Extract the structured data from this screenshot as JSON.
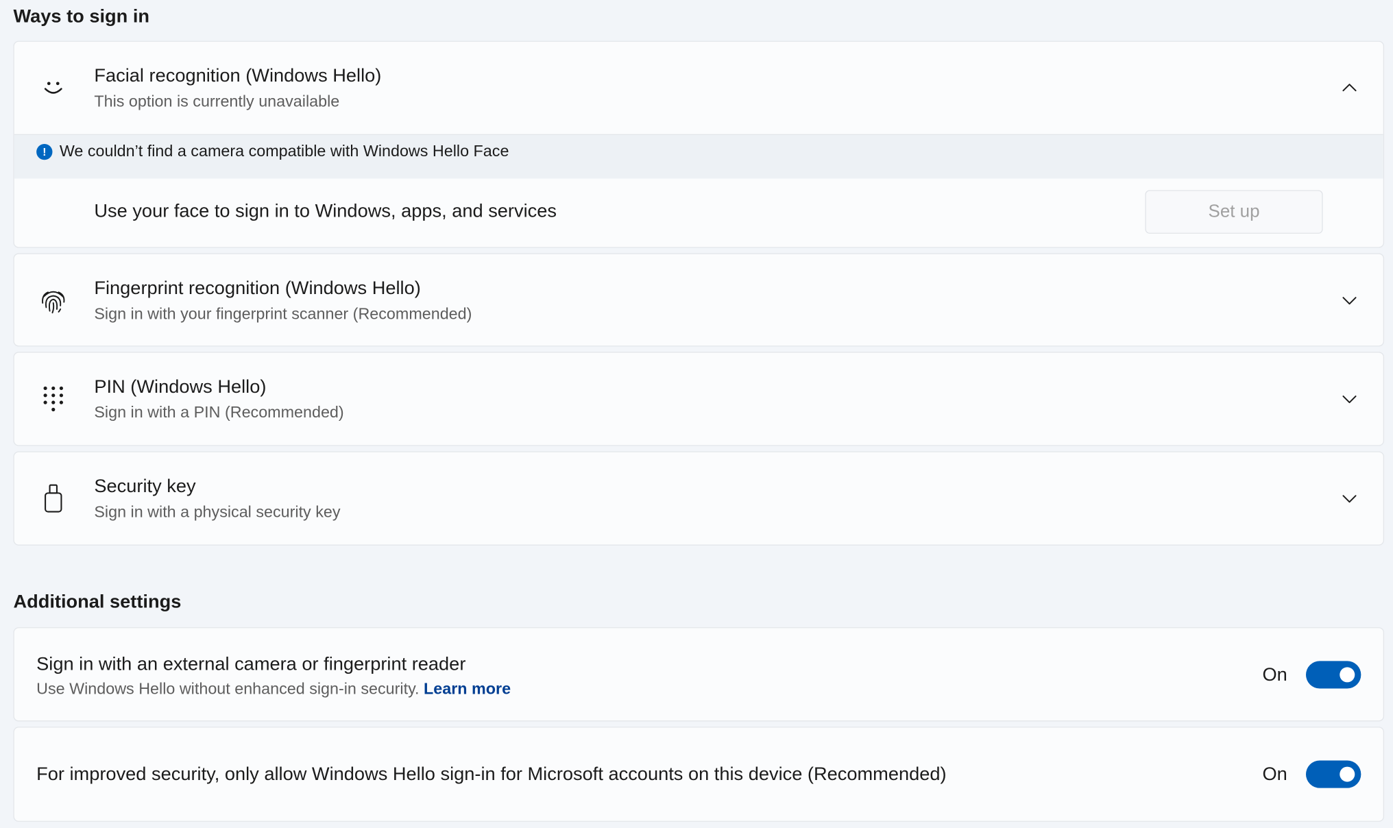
{
  "sections": {
    "ways_title": "Ways to sign in",
    "additional_title": "Additional settings"
  },
  "sign_in_options": [
    {
      "title": "Facial recognition (Windows Hello)",
      "subtitle": "This option is currently unavailable",
      "icon": "smile-face-icon",
      "expanded": true
    },
    {
      "title": "Fingerprint recognition (Windows Hello)",
      "subtitle": "Sign in with your fingerprint scanner (Recommended)",
      "icon": "fingerprint-icon",
      "expanded": false
    },
    {
      "title": "PIN (Windows Hello)",
      "subtitle": "Sign in with a PIN (Recommended)",
      "icon": "keypad-icon",
      "expanded": false
    },
    {
      "title": "Security key",
      "subtitle": "Sign in with a physical security key",
      "icon": "usb-key-icon",
      "expanded": false
    }
  ],
  "face": {
    "info_message": "We couldn’t find a camera compatible with Windows Hello Face",
    "description": "Use your face to sign in to Windows, apps, and services",
    "setup_label": "Set up"
  },
  "additional": {
    "external_camera": {
      "title": "Sign in with an external camera or fingerprint reader",
      "subtitle": "Use Windows Hello without enhanced sign-in security.",
      "link": "Learn more",
      "state": "On"
    },
    "improved_security": {
      "title": "For improved security, only allow Windows Hello sign-in for Microsoft accounts on this device (Recommended)",
      "state": "On"
    }
  },
  "colors": {
    "accent": "#005fb8",
    "info": "#0067c0",
    "link": "#003e92",
    "background": "#f2f5f9",
    "card": "#fbfcfd"
  }
}
